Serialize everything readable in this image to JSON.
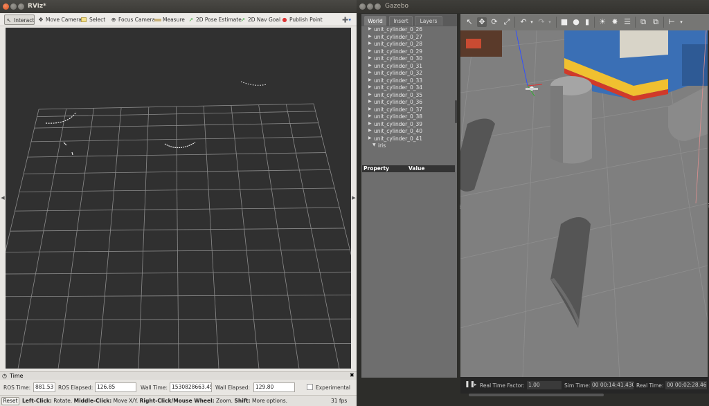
{
  "rviz": {
    "title": "RViz*",
    "toolbar": {
      "interact": "Interact",
      "move_camera": "Move Camera",
      "select": "Select",
      "focus_camera": "Focus Camera",
      "measure": "Measure",
      "pose_estimate": "2D Pose Estimate",
      "nav_goal": "2D Nav Goal",
      "publish_point": "Publish Point"
    },
    "time_panel": {
      "title": "Time",
      "ros_time_label": "ROS Time:",
      "ros_time": "881.53",
      "ros_elapsed_label": "ROS Elapsed:",
      "ros_elapsed": "126.85",
      "wall_time_label": "Wall Time:",
      "wall_time": "1530828663.45",
      "wall_elapsed_label": "Wall Elapsed:",
      "wall_elapsed": "129.80",
      "experimental_label": "Experimental"
    },
    "status": {
      "reset_label": "Reset",
      "hint_left_click": "Left-Click:",
      "hint_left_click_desc": " Rotate. ",
      "hint_middle_click": "Middle-Click:",
      "hint_middle_click_desc": " Move X/Y. ",
      "hint_right_click": "Right-Click/Mouse Wheel:",
      "hint_right_click_desc": " Zoom. ",
      "hint_shift": "Shift:",
      "hint_shift_desc": " More options.",
      "fps": "31 fps"
    }
  },
  "gazebo": {
    "title": "Gazebo",
    "tabs": [
      "World",
      "Insert",
      "Layers"
    ],
    "tree_items": [
      "unit_cylinder_0_26",
      "unit_cylinder_0_27",
      "unit_cylinder_0_28",
      "unit_cylinder_0_29",
      "unit_cylinder_0_30",
      "unit_cylinder_0_31",
      "unit_cylinder_0_32",
      "unit_cylinder_0_33",
      "unit_cylinder_0_34",
      "unit_cylinder_0_35",
      "unit_cylinder_0_36",
      "unit_cylinder_0_37",
      "unit_cylinder_0_38",
      "unit_cylinder_0_39",
      "unit_cylinder_0_40",
      "unit_cylinder_0_41"
    ],
    "tree_expanded_item": "iris",
    "property_header": "Property",
    "value_header": "Value",
    "bottom": {
      "real_time_factor_label": "Real Time Factor:",
      "real_time_factor": "1.00",
      "sim_time_label": "Sim Time:",
      "sim_time": "00 00:14:41.430",
      "real_time_label": "Real Time:",
      "real_time": "00 00:02:28.46"
    }
  }
}
